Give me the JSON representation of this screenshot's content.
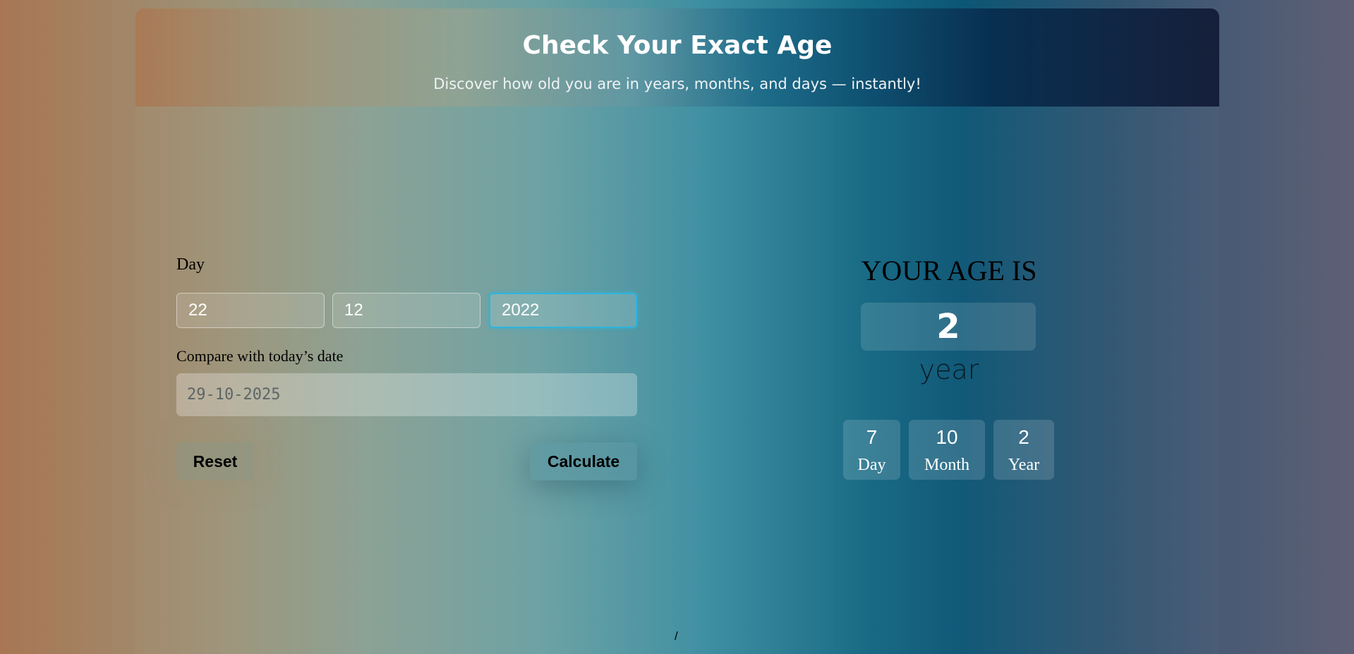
{
  "header": {
    "title": "Check Your Exact Age",
    "subtitle": "Discover how old you are in years, months, and days — instantly!"
  },
  "form": {
    "day_label": "Day",
    "day_value": "22",
    "month_value": "12",
    "year_value": "2022",
    "compare_label": "Compare with today’s date",
    "compare_placeholder": "29-10-2025",
    "reset_label": "Reset",
    "calculate_label": "Calculate"
  },
  "result": {
    "heading": "YOUR AGE IS",
    "main_value": "2",
    "main_unit": "year",
    "breakdown": [
      {
        "value": "7",
        "label": "Day"
      },
      {
        "value": "10",
        "label": "Month"
      },
      {
        "value": "2",
        "label": "Year"
      }
    ]
  },
  "footer": {
    "text": "/"
  },
  "colors": {
    "focus_ring": "#2fb4dc",
    "header_text": "#ffffff"
  }
}
